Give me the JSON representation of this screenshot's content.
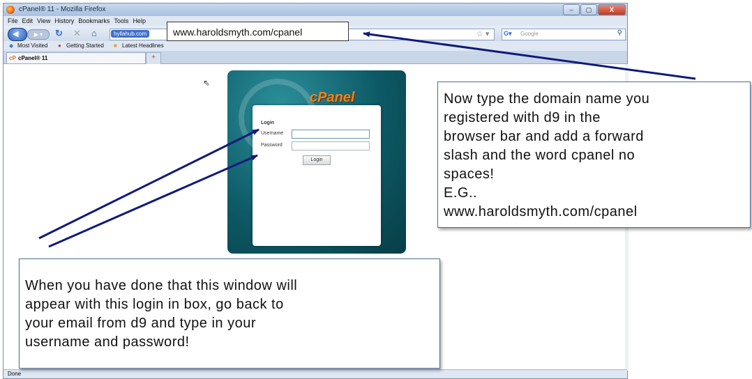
{
  "browser": {
    "window_title": "cPanel® 11 - Mozilla Firefox",
    "window_buttons": [
      "–",
      "▢",
      "X"
    ],
    "menu": [
      "File",
      "Edit",
      "View",
      "History",
      "Bookmarks",
      "Tools",
      "Help"
    ],
    "site_identity": "hyllahub.com",
    "search_placeholder": "Google",
    "bookmarks": [
      "Most Visited",
      "Getting Started",
      "Latest Headlines"
    ],
    "tab_title": "cPanel® 11",
    "new_tab": "+",
    "status": "Done"
  },
  "cpanel": {
    "logo": "cPanel",
    "login_title": "Login",
    "username_label": "Username",
    "password_label": "Password",
    "login_button": "Login"
  },
  "callouts": {
    "url": "www.haroldsmyth.com/cpanel",
    "right": "Now type the domain name you\nregistered with d9 in the\nbrowser bar and add a forward\nslash and the word cpanel no\nspaces!\nE.G..\nwww.haroldsmyth.com/cpanel",
    "bottom": "When you have done that this window will\nappear with this login in box, go back to\nyour email from d9 and type in your\nusername and password!"
  },
  "colors": {
    "arrow": "#0f1a7a",
    "cpanel_orange": "#f0821e",
    "cpanel_teal": "#0d5a66"
  }
}
